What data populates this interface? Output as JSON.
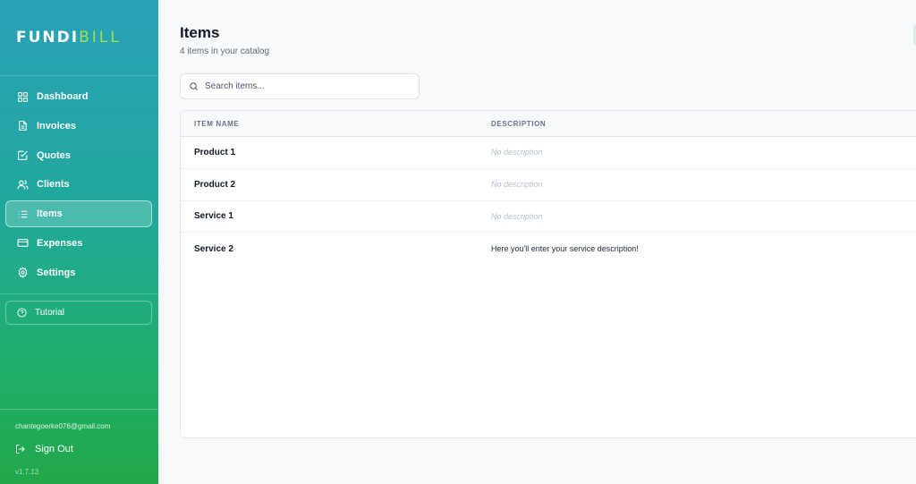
{
  "brand": {
    "part1": "FUNDI",
    "part2": "BILL"
  },
  "nav": [
    {
      "label": "Dashboard",
      "icon": "grid-icon"
    },
    {
      "label": "Invoices",
      "icon": "document-icon"
    },
    {
      "label": "Quotes",
      "icon": "checkbox-icon"
    },
    {
      "label": "Clients",
      "icon": "users-icon"
    },
    {
      "label": "Items",
      "icon": "list-icon",
      "active": true
    },
    {
      "label": "Expenses",
      "icon": "credit-card-icon"
    },
    {
      "label": "Settings",
      "icon": "gear-icon"
    }
  ],
  "tutorial": {
    "label": "Tutorial",
    "icon": "help-circle-icon"
  },
  "user": {
    "email": "chantegoerke076@gmail.com",
    "signout_label": "Sign Out",
    "version": "v1.7.13"
  },
  "header": {
    "title": "Items",
    "subtitle": "4 items in your catalog"
  },
  "search": {
    "placeholder": "Search items...",
    "value": ""
  },
  "table": {
    "columns": [
      "ITEM NAME",
      "DESCRIPTION"
    ],
    "rows": [
      {
        "name": "Product 1",
        "description": "No description",
        "empty": true
      },
      {
        "name": "Product 2",
        "description": "No description",
        "empty": true
      },
      {
        "name": "Service 1",
        "description": "No description",
        "empty": true
      },
      {
        "name": "Service 2",
        "description": "Here you'll enter your service description!",
        "empty": false
      }
    ]
  },
  "colors": {
    "sidebar_top": "#2aa0b8",
    "sidebar_bottom": "#22a84a",
    "brand_accent": "#9ee34f",
    "background": "#f7f9fb"
  }
}
